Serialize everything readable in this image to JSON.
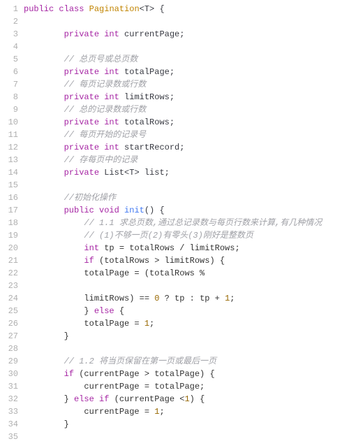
{
  "lines": [
    {
      "n": "1",
      "indent": 0,
      "tokens": [
        [
          "p-public",
          "public"
        ],
        [
          "",
          " "
        ],
        [
          "p-class",
          "class"
        ],
        [
          "",
          " "
        ],
        [
          "p-name",
          "Pagination"
        ],
        [
          "p-generic",
          "<T> {"
        ]
      ]
    },
    {
      "n": "2",
      "indent": 0,
      "tokens": []
    },
    {
      "n": "3",
      "indent": 2,
      "tokens": [
        [
          "p-private",
          "private"
        ],
        [
          "",
          " "
        ],
        [
          "p-int",
          "int"
        ],
        [
          "",
          " "
        ],
        [
          "p-var",
          "currentPage;"
        ]
      ]
    },
    {
      "n": "4",
      "indent": 0,
      "tokens": []
    },
    {
      "n": "5",
      "indent": 2,
      "tokens": [
        [
          "comment",
          "// 总页号或总页数"
        ]
      ]
    },
    {
      "n": "6",
      "indent": 2,
      "tokens": [
        [
          "p-private",
          "private"
        ],
        [
          "",
          " "
        ],
        [
          "p-int",
          "int"
        ],
        [
          "",
          " "
        ],
        [
          "p-var",
          "totalPage;"
        ]
      ]
    },
    {
      "n": "7",
      "indent": 2,
      "tokens": [
        [
          "comment",
          "// 每页记录数或行数"
        ]
      ]
    },
    {
      "n": "8",
      "indent": 2,
      "tokens": [
        [
          "p-private",
          "private"
        ],
        [
          "",
          " "
        ],
        [
          "p-int",
          "int"
        ],
        [
          "",
          " "
        ],
        [
          "p-var",
          "limitRows;"
        ]
      ]
    },
    {
      "n": "9",
      "indent": 2,
      "tokens": [
        [
          "comment",
          "// 总的记录数或行数"
        ]
      ]
    },
    {
      "n": "10",
      "indent": 2,
      "tokens": [
        [
          "p-private",
          "private"
        ],
        [
          "",
          " "
        ],
        [
          "p-int",
          "int"
        ],
        [
          "",
          " "
        ],
        [
          "p-var",
          "totalRows;"
        ]
      ]
    },
    {
      "n": "11",
      "indent": 2,
      "tokens": [
        [
          "comment",
          "// 每页开始的记录号"
        ]
      ]
    },
    {
      "n": "12",
      "indent": 2,
      "tokens": [
        [
          "p-private",
          "private"
        ],
        [
          "",
          " "
        ],
        [
          "p-int",
          "int"
        ],
        [
          "",
          " "
        ],
        [
          "p-var",
          "startRecord;"
        ]
      ]
    },
    {
      "n": "13",
      "indent": 2,
      "tokens": [
        [
          "comment",
          "// 存每页中的记录"
        ]
      ]
    },
    {
      "n": "14",
      "indent": 2,
      "tokens": [
        [
          "p-private",
          "private"
        ],
        [
          "",
          " "
        ],
        [
          "p-List",
          "List<T>"
        ],
        [
          "",
          " "
        ],
        [
          "p-var",
          "list;"
        ]
      ]
    },
    {
      "n": "15",
      "indent": 0,
      "tokens": []
    },
    {
      "n": "16",
      "indent": 2,
      "tokens": [
        [
          "comment",
          "//初始化操作"
        ]
      ]
    },
    {
      "n": "17",
      "indent": 2,
      "tokens": [
        [
          "p-public",
          "public"
        ],
        [
          "",
          " "
        ],
        [
          "p-void",
          "void"
        ],
        [
          "",
          " "
        ],
        [
          "p-fn",
          "init"
        ],
        [
          "p-brace",
          "() {"
        ]
      ]
    },
    {
      "n": "18",
      "indent": 3,
      "tokens": [
        [
          "comment",
          "// 1.1 求总页数,通过总记录数与每页行数来计算,有几种情况"
        ]
      ]
    },
    {
      "n": "19",
      "indent": 3,
      "tokens": [
        [
          "comment",
          "// (1)不够一页(2)有零头(3)刚好是整数页"
        ]
      ]
    },
    {
      "n": "20",
      "indent": 3,
      "tokens": [
        [
          "p-int",
          "int"
        ],
        [
          "",
          " tp = totalRows / limitRows;"
        ]
      ]
    },
    {
      "n": "21",
      "indent": 3,
      "tokens": [
        [
          "p-if",
          "if"
        ],
        [
          "",
          " (totalRows > limitRows) {"
        ]
      ]
    },
    {
      "n": "22",
      "indent": 3,
      "tokens": [
        [
          "",
          "totalPage = (totalRows %"
        ]
      ]
    },
    {
      "n": "23",
      "indent": 0,
      "tokens": []
    },
    {
      "n": "24",
      "indent": 3,
      "tokens": [
        [
          "",
          "limitRows) == "
        ],
        [
          "p-num",
          "0"
        ],
        [
          "",
          " ? tp : tp + "
        ],
        [
          "p-num",
          "1"
        ],
        [
          "",
          ";"
        ]
      ]
    },
    {
      "n": "25",
      "indent": 3,
      "tokens": [
        [
          "",
          "} "
        ],
        [
          "p-else",
          "else"
        ],
        [
          "",
          " {"
        ]
      ]
    },
    {
      "n": "26",
      "indent": 3,
      "tokens": [
        [
          "",
          "totalPage = "
        ],
        [
          "p-num",
          "1"
        ],
        [
          "",
          ";"
        ]
      ]
    },
    {
      "n": "27",
      "indent": 2,
      "tokens": [
        [
          "",
          "}"
        ]
      ]
    },
    {
      "n": "28",
      "indent": 0,
      "tokens": []
    },
    {
      "n": "29",
      "indent": 2,
      "tokens": [
        [
          "comment",
          "// 1.2 将当页保留在第一页或最后一页"
        ]
      ]
    },
    {
      "n": "30",
      "indent": 2,
      "tokens": [
        [
          "p-if",
          "if"
        ],
        [
          "",
          " (currentPage > totalPage) {"
        ]
      ]
    },
    {
      "n": "31",
      "indent": 3,
      "tokens": [
        [
          "",
          "currentPage = totalPage;"
        ]
      ]
    },
    {
      "n": "32",
      "indent": 2,
      "tokens": [
        [
          "",
          "} "
        ],
        [
          "p-else",
          "else"
        ],
        [
          "",
          " "
        ],
        [
          "p-if",
          "if"
        ],
        [
          "",
          " (currentPage <"
        ],
        [
          "p-num",
          "1"
        ],
        [
          "",
          ") {"
        ]
      ]
    },
    {
      "n": "33",
      "indent": 3,
      "tokens": [
        [
          "",
          "currentPage = "
        ],
        [
          "p-num",
          "1"
        ],
        [
          "",
          ";"
        ]
      ]
    },
    {
      "n": "34",
      "indent": 2,
      "tokens": [
        [
          "",
          "}"
        ]
      ]
    },
    {
      "n": "35",
      "indent": 0,
      "tokens": []
    }
  ],
  "indentUnit": "    "
}
